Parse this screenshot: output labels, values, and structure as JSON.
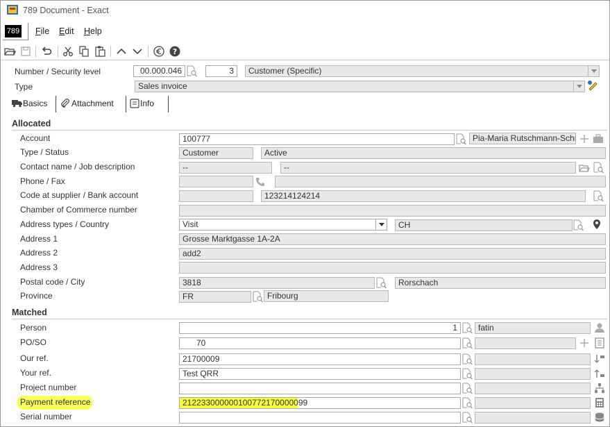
{
  "window": {
    "title": "789 Document - Exact",
    "logo_text": "789"
  },
  "menu": {
    "file": "File",
    "file_key": "F",
    "file_rest": "ile",
    "edit_key": "E",
    "edit_rest": "dit",
    "help_key": "H",
    "help_rest": "elp"
  },
  "toolbar": {
    "icons": [
      "open-folder-icon",
      "save-icon",
      "undo-icon",
      "cut-icon",
      "copy-icon",
      "paste-icon",
      "up-arrow-icon",
      "down-arrow-icon",
      "euro-icon",
      "help-icon"
    ]
  },
  "header": {
    "number_label": "Number / Security level",
    "number_value": "00.000.046",
    "security_value": "3",
    "security_text": "Customer (Specific)",
    "type_label": "Type",
    "type_value": "Sales invoice"
  },
  "tabs": {
    "basics": "Basics",
    "attachment": "Attachment",
    "info": "Info"
  },
  "allocated": {
    "title": "Allocated",
    "account_label": "Account",
    "account_value": "100777",
    "account_name": "Pia-Maria Rutschmann-Schny",
    "type_status_label": "Type / Status",
    "type_value": "Customer",
    "status_value": "Active",
    "contact_label": "Contact name / Job description",
    "contact_value": "--",
    "job_value": "--",
    "phone_label": "Phone / Fax",
    "code_label": "Code at supplier / Bank account",
    "bank_value": "123214124214",
    "chamber_label": "Chamber of Commerce number",
    "address_types_label": "Address types / Country",
    "address_type_value": "Visit",
    "country_value": "CH",
    "address1_label": "Address 1",
    "address1_value": "Grosse Marktgasse 1A-2A",
    "address2_label": "Address 2",
    "address2_value": "add2",
    "address3_label": "Address 3",
    "postal_label": "Postal code / City",
    "postal_value": "3818",
    "city_value": "Rorschach",
    "province_label": "Province",
    "province_code": "FR",
    "province_name": "Fribourg"
  },
  "matched": {
    "title": "Matched",
    "person_label": "Person",
    "person_number": "1",
    "person_name": "fatin",
    "poso_label": "PO/SO",
    "poso_value": "70",
    "our_ref_label": "Our ref.",
    "our_ref_value": "21700009",
    "your_ref_label": "Your ref.",
    "your_ref_value": "Test QRR",
    "project_label": "Project number",
    "payment_ref_label": "Payment reference",
    "payment_ref_value": "212233000000100772170000099",
    "serial_label": "Serial number"
  },
  "colors": {
    "highlight": "#f6ff3c",
    "readonly_bg": "#e8e8e8"
  }
}
